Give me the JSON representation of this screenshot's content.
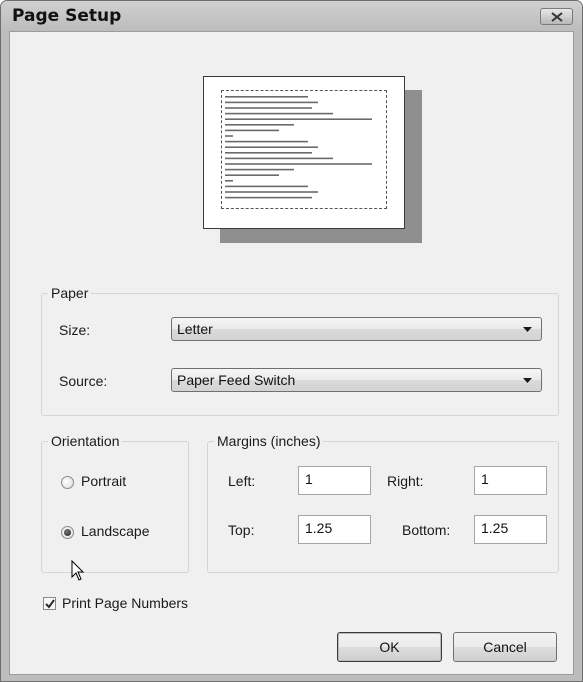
{
  "window": {
    "title": "Page Setup",
    "close_icon": "close-x-icon"
  },
  "preview": {
    "line_count": 19,
    "lines": [
      "",
      "",
      "",
      "",
      "",
      "",
      "",
      "",
      "",
      "",
      "",
      "",
      "",
      "",
      "",
      "",
      "",
      "",
      ""
    ]
  },
  "paper": {
    "legend": "Paper",
    "size_label": "Size:",
    "size_value": "Letter",
    "source_label": "Source:",
    "source_value": "Paper Feed Switch"
  },
  "orientation": {
    "legend": "Orientation",
    "portrait_label": "Portrait",
    "landscape_label": "Landscape",
    "selected": "Landscape"
  },
  "margins": {
    "legend": "Margins (inches)",
    "left_label": "Left:",
    "left_value": "1",
    "right_label": "Right:",
    "right_value": "1",
    "top_label": "Top:",
    "top_value": "1.25",
    "bottom_label": "Bottom:",
    "bottom_value": "1.25"
  },
  "print_page_numbers": {
    "label": "Print Page Numbers",
    "checked": true
  },
  "buttons": {
    "ok": "OK",
    "cancel": "Cancel"
  }
}
